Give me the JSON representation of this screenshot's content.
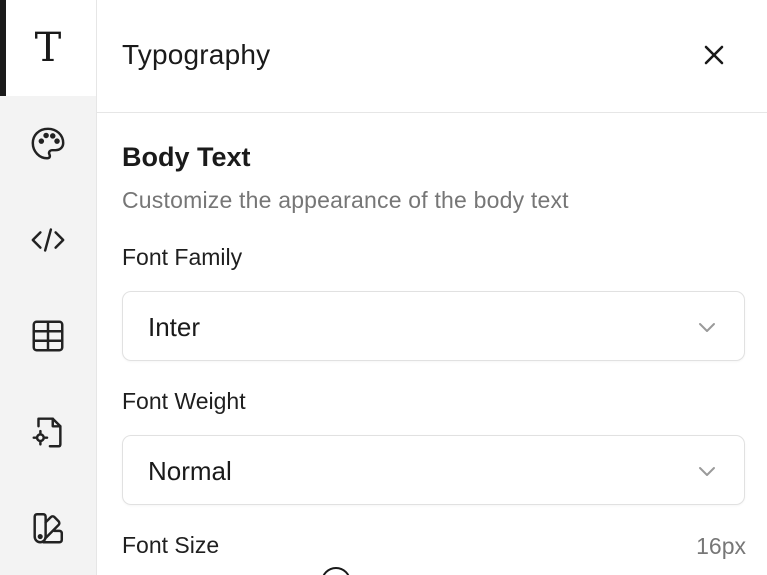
{
  "rail": {
    "items": [
      {
        "icon": "text-type-icon",
        "glyph": "T",
        "active": true
      },
      {
        "icon": "palette-icon",
        "active": false
      },
      {
        "icon": "code-icon",
        "active": false
      },
      {
        "icon": "table-icon",
        "active": false
      },
      {
        "icon": "file-settings-icon",
        "active": false
      },
      {
        "icon": "swatch-book-icon",
        "active": false
      }
    ]
  },
  "header": {
    "title": "Typography"
  },
  "section": {
    "title": "Body Text",
    "description": "Customize the appearance of the body text"
  },
  "fields": {
    "font_family": {
      "label": "Font Family",
      "value": "Inter"
    },
    "font_weight": {
      "label": "Font Weight",
      "value": "Normal"
    },
    "font_size": {
      "label": "Font Size",
      "value": "16px"
    }
  },
  "colors": {
    "accent": "#1a1a1a",
    "muted_text": "#767676",
    "rail_bg": "#f3f3f3",
    "border": "#e1e1e1"
  }
}
